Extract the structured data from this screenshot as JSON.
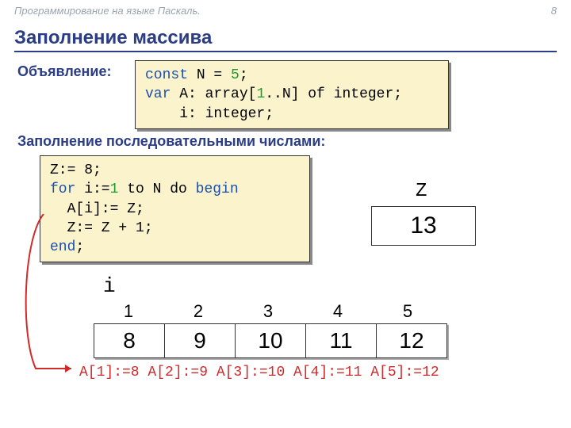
{
  "header": {
    "course": "Программирование на языке Паскаль.",
    "page": "8"
  },
  "title": "Заполнение массива",
  "decl_label": "Объявление:",
  "decl_code": {
    "const_kw": "const",
    "n_name": " N",
    "eq": " = ",
    "n_val": "5",
    "semi": ";",
    "var_kw": "var",
    "arr_decl1": " A: array[",
    "one": "1",
    "arr_decl2": "..N] of integer;",
    "i_decl": "    i: integer;"
  },
  "fill_label": "Заполнение последовательными числами:",
  "fill_code": {
    "l1": "Z:= 8;",
    "for_kw": "for",
    "mid1": " i:=",
    "one": "1",
    "mid2": " to N do ",
    "begin_kw": "begin",
    "l3a": "  A[i]:=",
    "l3b": " Z;",
    "l4": "  Z:= Z + 1;",
    "end_kw": "end",
    "end_semi": ";"
  },
  "z": {
    "label": "Z",
    "value": "13"
  },
  "i_label": "i",
  "indices": [
    "1",
    "2",
    "3",
    "4",
    "5"
  ],
  "cells": [
    "8",
    "9",
    "10",
    "11",
    "12"
  ],
  "assigns": "A[1]:=8 A[2]:=9 A[3]:=10 A[4]:=11 A[5]:=12"
}
